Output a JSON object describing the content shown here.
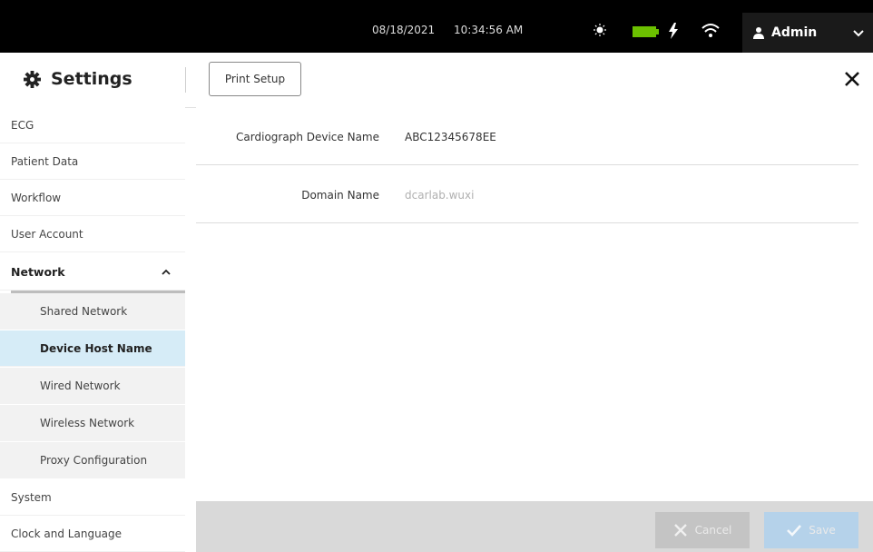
{
  "status": {
    "date": "08/18/2021",
    "time": "10:34:56 AM",
    "user": "Admin"
  },
  "header": {
    "title": "Settings",
    "print_setup": "Print Setup"
  },
  "sidebar": {
    "items": [
      {
        "label": "ECG"
      },
      {
        "label": "Patient Data"
      },
      {
        "label": "Workflow"
      },
      {
        "label": "User Account"
      },
      {
        "label": "Network"
      },
      {
        "label": "Shared Network"
      },
      {
        "label": "Device Host Name"
      },
      {
        "label": "Wired Network"
      },
      {
        "label": "Wireless Network"
      },
      {
        "label": "Proxy Configuration"
      },
      {
        "label": "System"
      },
      {
        "label": "Clock and Language"
      }
    ]
  },
  "main": {
    "fields": [
      {
        "label": "Cardiograph Device Name",
        "value": "ABC12345678EE"
      },
      {
        "label": "Domain Name",
        "value": "dcarlab.wuxi"
      }
    ]
  },
  "footer": {
    "cancel": "Cancel",
    "save": "Save"
  },
  "colors": {
    "active_nav": "#d6ecf7",
    "battery": "#6cc000",
    "status_bar": "#000000"
  }
}
